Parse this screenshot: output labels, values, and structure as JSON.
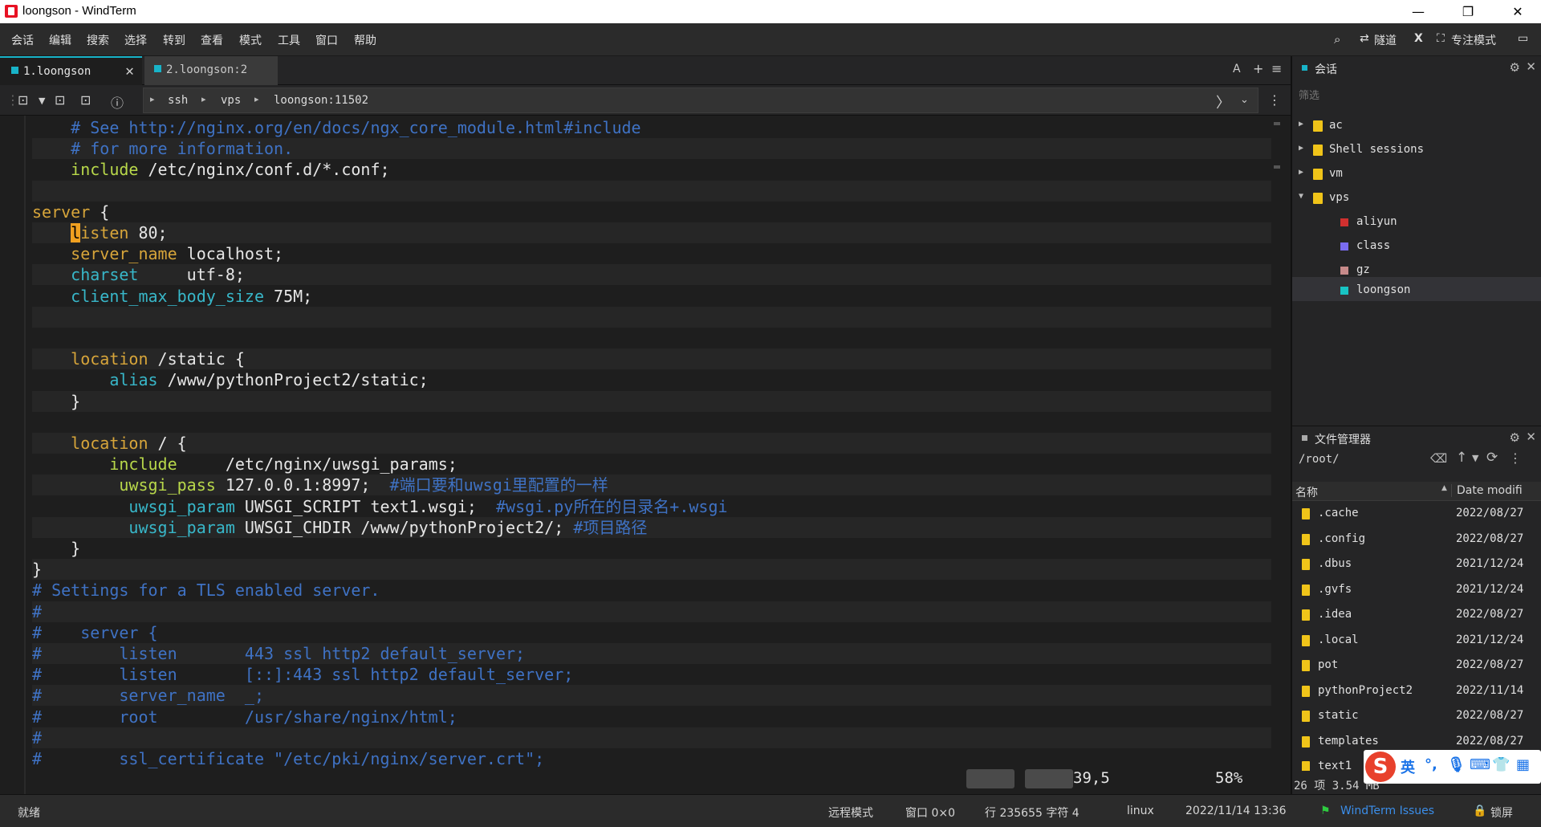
{
  "window": {
    "title": "loongson - WindTerm",
    "min": "—",
    "max": "❐",
    "close": "✕"
  },
  "menu": [
    "会话",
    "编辑",
    "搜索",
    "选择",
    "转到",
    "查看",
    "模式",
    "工具",
    "窗口",
    "帮助"
  ],
  "toolbar_right": {
    "tunnel": "隧道",
    "focus_mode": "专注模式"
  },
  "tabs": [
    {
      "label": "1.loongson",
      "close": "✕"
    },
    {
      "label": "2.loongson:2"
    }
  ],
  "tab_tools": [
    "A",
    "+",
    "≡"
  ],
  "breadcrumb": [
    "ssh",
    "vps",
    "loongson:11502"
  ],
  "terminal_lines": [
    [
      {
        "t": "    ",
        "c": "txt"
      },
      {
        "t": "# See http://nginx.org/en/docs/ngx_core_module.html#include",
        "c": "cm"
      }
    ],
    [
      {
        "t": "    ",
        "c": "txt"
      },
      {
        "t": "# for more information.",
        "c": "cm"
      }
    ],
    [
      {
        "t": "    ",
        "c": "txt"
      },
      {
        "t": "include",
        "c": "dir"
      },
      {
        "t": " /etc/nginx/conf.d/*.conf;",
        "c": "txt"
      }
    ],
    [
      {
        "t": "",
        "c": "txt"
      }
    ],
    [
      {
        "t": "server",
        "c": "kw"
      },
      {
        "t": " {",
        "c": "txt"
      }
    ],
    [
      {
        "t": "    ",
        "c": "txt"
      },
      {
        "t": "l",
        "c": "cursor"
      },
      {
        "t": "isten",
        "c": "kw"
      },
      {
        "t": " 80;",
        "c": "txt"
      }
    ],
    [
      {
        "t": "    ",
        "c": "txt"
      },
      {
        "t": "server_name",
        "c": "kw"
      },
      {
        "t": " localhost;",
        "c": "txt"
      }
    ],
    [
      {
        "t": "    ",
        "c": "txt"
      },
      {
        "t": "charset",
        "c": "sv"
      },
      {
        "t": "     utf-8;",
        "c": "txt"
      }
    ],
    [
      {
        "t": "    ",
        "c": "txt"
      },
      {
        "t": "client_max_body_size",
        "c": "sv"
      },
      {
        "t": " 75M;",
        "c": "txt"
      }
    ],
    [
      {
        "t": "",
        "c": "txt"
      }
    ],
    [
      {
        "t": "",
        "c": "txt"
      }
    ],
    [
      {
        "t": "    ",
        "c": "txt"
      },
      {
        "t": "location",
        "c": "kw"
      },
      {
        "t": " /static {",
        "c": "txt"
      }
    ],
    [
      {
        "t": "        ",
        "c": "txt"
      },
      {
        "t": "alias",
        "c": "sv"
      },
      {
        "t": " /www/pythonProject2/static;",
        "c": "txt"
      }
    ],
    [
      {
        "t": "    }",
        "c": "txt"
      }
    ],
    [
      {
        "t": "",
        "c": "txt"
      }
    ],
    [
      {
        "t": "    ",
        "c": "txt"
      },
      {
        "t": "location",
        "c": "kw"
      },
      {
        "t": " / {",
        "c": "txt"
      }
    ],
    [
      {
        "t": "        ",
        "c": "txt"
      },
      {
        "t": "include",
        "c": "dir"
      },
      {
        "t": "     /etc/nginx/uwsgi_params;",
        "c": "txt"
      }
    ],
    [
      {
        "t": "         ",
        "c": "txt"
      },
      {
        "t": "uwsgi_pass",
        "c": "dir"
      },
      {
        "t": " 127.0.0.1:8997;  ",
        "c": "txt"
      },
      {
        "t": "#端口要和uwsgi里配置的一样",
        "c": "cm"
      }
    ],
    [
      {
        "t": "          ",
        "c": "txt"
      },
      {
        "t": "uwsgi_param",
        "c": "sv"
      },
      {
        "t": " UWSGI_SCRIPT text1.wsgi;  ",
        "c": "txt"
      },
      {
        "t": "#wsgi.py所在的目录名+.wsgi",
        "c": "cm"
      }
    ],
    [
      {
        "t": "          ",
        "c": "txt"
      },
      {
        "t": "uwsgi_param",
        "c": "sv"
      },
      {
        "t": " UWSGI_CHDIR /www/pythonProject2/; ",
        "c": "txt"
      },
      {
        "t": "#项目路径",
        "c": "cm"
      }
    ],
    [
      {
        "t": "    }",
        "c": "txt"
      }
    ],
    [
      {
        "t": "}",
        "c": "txt"
      }
    ],
    [
      {
        "t": "# Settings for a TLS enabled server.",
        "c": "cm"
      }
    ],
    [
      {
        "t": "#",
        "c": "cm"
      }
    ],
    [
      {
        "t": "#    server {",
        "c": "cm"
      }
    ],
    [
      {
        "t": "#        listen       443 ssl http2 default_server;",
        "c": "cm"
      }
    ],
    [
      {
        "t": "#        listen       [::]:443 ssl http2 default_server;",
        "c": "cm"
      }
    ],
    [
      {
        "t": "#        server_name  _;",
        "c": "cm"
      }
    ],
    [
      {
        "t": "#        root         /usr/share/nginx/html;",
        "c": "cm"
      }
    ],
    [
      {
        "t": "#",
        "c": "cm"
      }
    ],
    [
      {
        "t": "#        ssl_certificate \"/etc/pki/nginx/server.crt\";",
        "c": "cm"
      }
    ]
  ],
  "terminal_info": {
    "cursor_pos": "39,5",
    "percent": "58%"
  },
  "sessions": {
    "title": "会话",
    "filter_placeholder": "筛选",
    "items": [
      {
        "label": "ac",
        "type": "folder",
        "expanded": false
      },
      {
        "label": "Shell sessions",
        "type": "folder",
        "expanded": false
      },
      {
        "label": "vm",
        "type": "folder",
        "expanded": false
      },
      {
        "label": "vps",
        "type": "folder",
        "expanded": true
      },
      {
        "label": "aliyun",
        "type": "session",
        "color": "#d0302f"
      },
      {
        "label": "class",
        "type": "session",
        "color": "#7a6cf0"
      },
      {
        "label": "gz",
        "type": "session",
        "color": "#c78a8a"
      },
      {
        "label": "loongson",
        "type": "session",
        "color": "#18c4c4"
      }
    ]
  },
  "file_manager": {
    "title": "文件管理器",
    "path": "/root/",
    "col_name": "名称",
    "col_date": "Date modifi",
    "rows": [
      {
        "name": ".cache",
        "date": "2022/08/27"
      },
      {
        "name": ".config",
        "date": "2022/08/27"
      },
      {
        "name": ".dbus",
        "date": "2021/12/24"
      },
      {
        "name": ".gvfs",
        "date": "2021/12/24"
      },
      {
        "name": ".idea",
        "date": "2022/08/27"
      },
      {
        "name": ".local",
        "date": "2021/12/24"
      },
      {
        "name": "pot",
        "date": "2022/08/27"
      },
      {
        "name": "pythonProject2",
        "date": "2022/11/14"
      },
      {
        "name": "static",
        "date": "2022/08/27"
      },
      {
        "name": "templates",
        "date": "2022/08/27"
      },
      {
        "name": "text1",
        "date": ""
      }
    ],
    "footer": "26 项 3.54 MB"
  },
  "ime": {
    "logo": "S",
    "lang": "英"
  },
  "status": {
    "ready": "就绪",
    "remote_mode": "远程模式",
    "window": "窗口 0×0",
    "position": "行 235655 字符 4",
    "os": "linux",
    "datetime": "2022/11/14 13:36",
    "issues": "WindTerm Issues",
    "lock": "锁屏"
  }
}
